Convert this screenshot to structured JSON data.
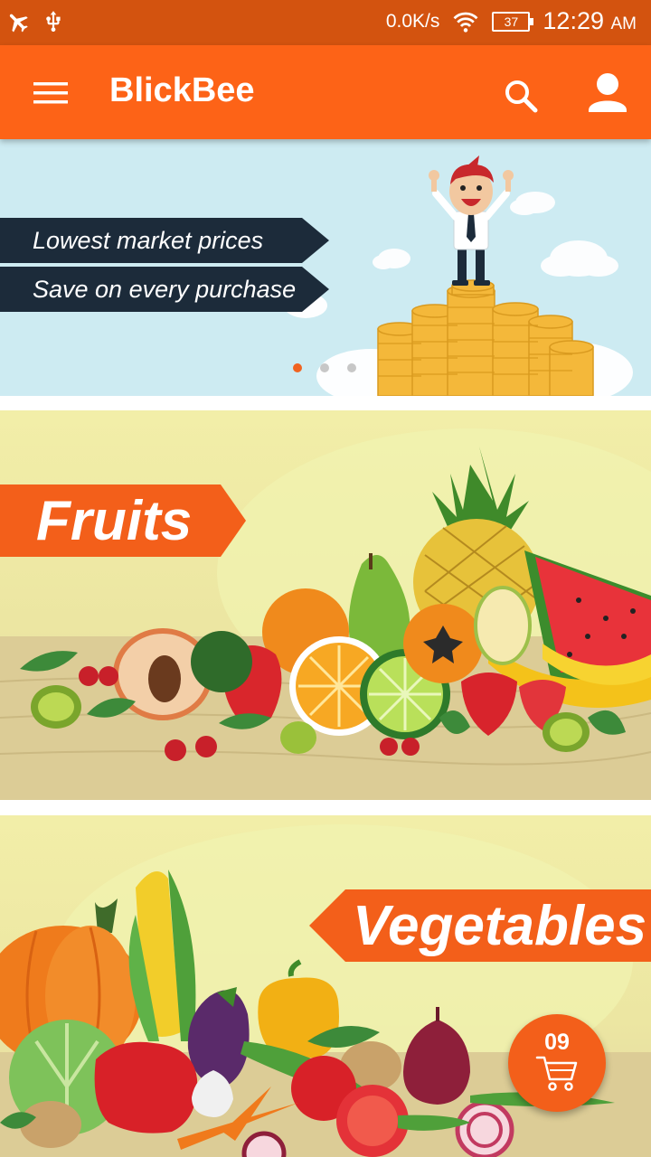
{
  "status_bar": {
    "net_speed": "0.0K/s",
    "battery": "37",
    "time": "12:29",
    "ampm": "AM",
    "icons": [
      "airplane-icon",
      "usb-icon",
      "wifi-icon",
      "battery-icon"
    ]
  },
  "app_bar": {
    "title": "BlickBee",
    "icons": [
      "menu-icon",
      "search-icon",
      "profile-icon"
    ]
  },
  "banner": {
    "lines": [
      "Lowest market prices",
      "Save on every purchase"
    ],
    "slide_count": 3,
    "active_slide": 1
  },
  "categories": [
    {
      "label": "Fruits"
    },
    {
      "label": "Vegetables"
    }
  ],
  "cart": {
    "count": "09",
    "icon": "cart-icon"
  },
  "colors": {
    "status_bar": "#d3530f",
    "app_bar": "#fd6317",
    "accent": "#f35f1a",
    "banner_bg": "#cdebf2",
    "tag_bg": "#1c2b3a"
  }
}
